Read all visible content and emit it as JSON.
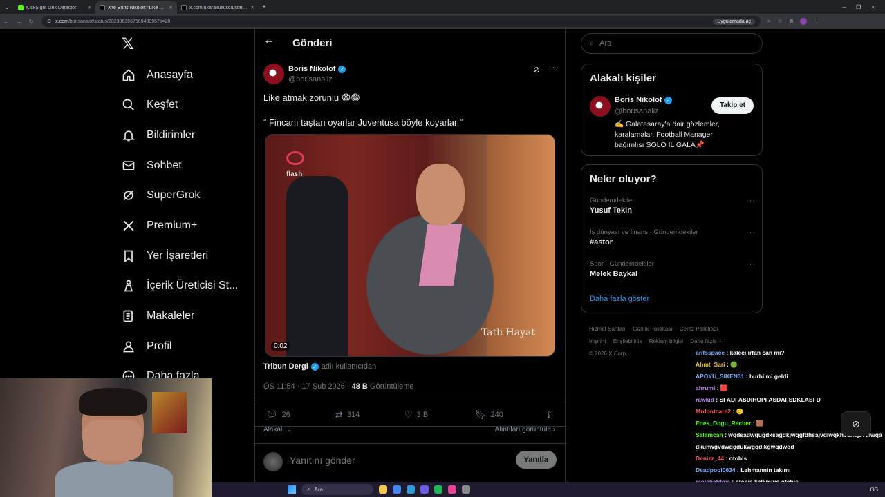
{
  "browser": {
    "tabs": [
      {
        "title": "KickSight Link Detector",
        "active": false
      },
      {
        "title": "X'te Boris Nikolof: \"Like atmak",
        "active": true
      },
      {
        "title": "x.com/ukarakullukcu/status/20",
        "active": false
      }
    ],
    "url_host": "x.com",
    "url_path": "/borisanaliz/status/2023863667669400957s=20",
    "open_in_app": "Uygulamada aç"
  },
  "nav": {
    "items": [
      {
        "label": "Anasayfa",
        "icon": "home-icon"
      },
      {
        "label": "Keşfet",
        "icon": "search-icon"
      },
      {
        "label": "Bildirimler",
        "icon": "bell-icon"
      },
      {
        "label": "Sohbet",
        "icon": "mail-icon"
      },
      {
        "label": "SuperGrok",
        "icon": "grok-icon"
      },
      {
        "label": "Premium+",
        "icon": "x-premium-icon"
      },
      {
        "label": "Yer İşaretleri",
        "icon": "bookmark-icon"
      },
      {
        "label": "İçerik Üreticisi St...",
        "icon": "creator-icon"
      },
      {
        "label": "Makaleler",
        "icon": "article-icon"
      },
      {
        "label": "Profil",
        "icon": "profile-icon"
      },
      {
        "label": "Daha fazla",
        "icon": "more-circle-icon"
      }
    ]
  },
  "post": {
    "header_title": "Gönderi",
    "author_name": "Boris Nikolof",
    "author_handle": "@borisanaliz",
    "text_line1": "Like atmak zorunlu 😁😁",
    "text_line2": "“ Fincanı taştan oyarlar Juventusa böyle koyarlar “",
    "media_watermark": "Tatlı Hayat",
    "media_logo": "flash",
    "media_time": "0:02",
    "source_name": "Tribun Dergi",
    "source_suffix": "adlı kullanıcıdan",
    "time": "ÖS 11:54 · 17 Şub 2026 · ",
    "views_count": "48 B",
    "views_label": "Görüntüleme",
    "replies": "26",
    "reposts": "314",
    "likes": "3 B",
    "bookmarks": "240",
    "relevant_label": "Alakalı",
    "quotes_label": "Alıntıları görüntüle",
    "reply_placeholder": "Yanıtını gönder",
    "reply_button": "Yanıtla"
  },
  "sidebar": {
    "search_placeholder": "Ara",
    "related_title": "Alakalı kişiler",
    "related_name": "Boris Nikolof",
    "related_handle": "@borisanaliz",
    "follow_label": "Takip et",
    "related_bio": "✍️ Galatasaray'a dair gözlemler, karalamalar. Football Manager bağımlısı SOLO IL GALA📌",
    "trends_title": "Neler oluyor?",
    "trends": [
      {
        "category": "Gündemdekiler",
        "name": "Yusuf Tekin"
      },
      {
        "category": "İş dünyası ve finans · Gündemdekiler",
        "name": "#astor"
      },
      {
        "category": "Spor · Gündemdekiler",
        "name": "Melek Baykal"
      }
    ],
    "show_more": "Daha fazla göster",
    "footer": [
      "Hizmet Şartları",
      "Gizlilik Politikası",
      "Çerez Politikası",
      "Imprint",
      "Erişilebilirlik",
      "Reklam bilgisi",
      "Daha fazla ···",
      "© 2026 X Corp."
    ]
  },
  "chat": [
    {
      "user": "arifsspace",
      "color": "#7fb2ff",
      "text": "kaleci irfan can mı?"
    },
    {
      "user": "Ahmt_Sari",
      "color": "#f5c542",
      "text": "🟢"
    },
    {
      "user": "APOYU_SIKEN31",
      "color": "#7fb2ff",
      "text": "burhi mi geldi"
    },
    {
      "user": "ahrumi",
      "color": "#c28bff",
      "text": "🟥"
    },
    {
      "user": "rawkid",
      "color": "#c28bff",
      "text": "SFADFASDIHOPFASDAFSDKLASFD"
    },
    {
      "user": "Mrdontcare2",
      "color": "#ff5a5a",
      "text": "🙂"
    },
    {
      "user": "Enes_Dogu_Recber",
      "color": "#53fc18",
      "text": "🟫"
    },
    {
      "user": "Salamcan",
      "color": "#53fc18",
      "text": "wqdsadwqugdksagdkjwqgfdhsajvdiwqkhvdhajsvdiwqadkuhwgvdwqgdukwgqdikgwqdwqd"
    },
    {
      "user": "Denizz_44",
      "color": "#ff5a5a",
      "text": "otobis"
    },
    {
      "user": "Deadpool0634",
      "color": "#7fb2ff",
      "text": "Lehmannin takımı"
    },
    {
      "user": "molchatdoja",
      "color": "#c28bff",
      "text": "otebis kalkmıyo otebis"
    }
  ],
  "taskbar": {
    "search": "Ara",
    "time": "ÖS"
  }
}
